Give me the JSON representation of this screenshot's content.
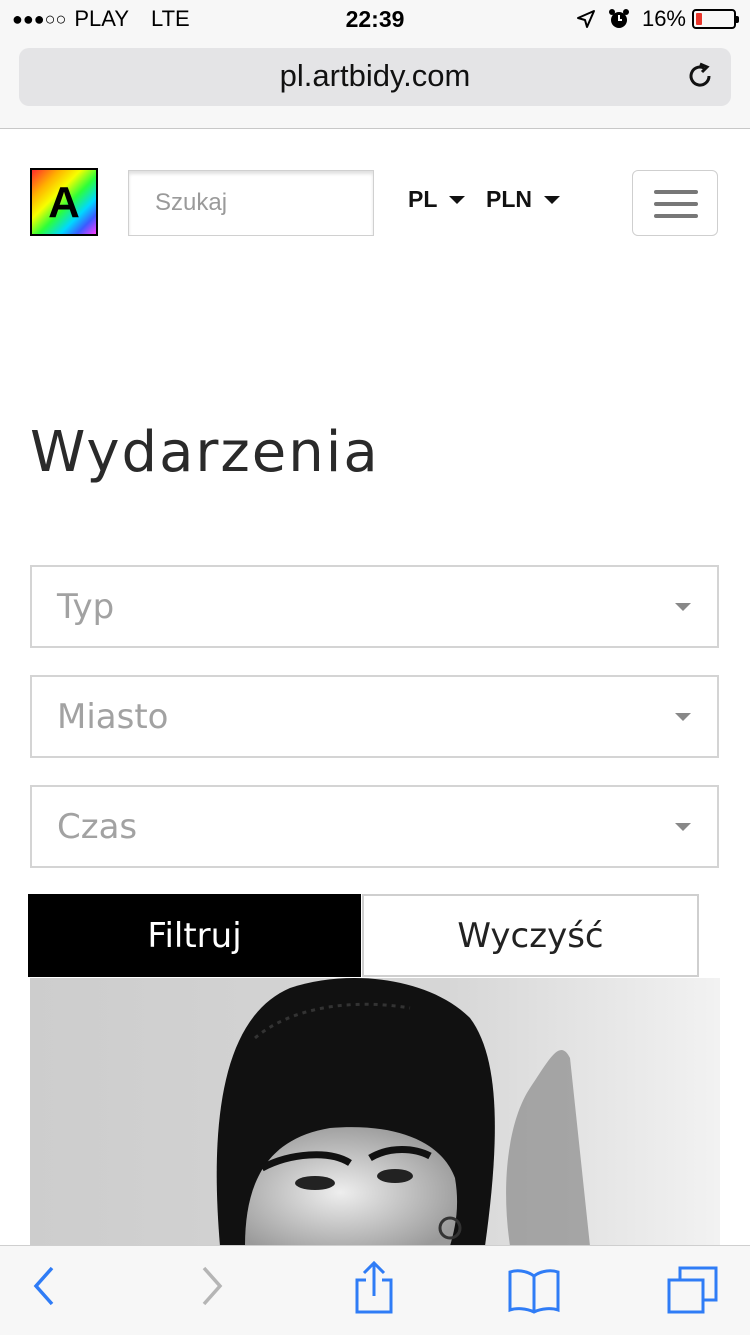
{
  "status_bar": {
    "signal_dots": "●●●○○",
    "carrier": "PLAY",
    "network": "LTE",
    "time": "22:39",
    "battery_percent": "16%",
    "battery_level": 0.16,
    "battery_color": "#e8352b"
  },
  "browser": {
    "url": "pl.artbidy.com",
    "icons": {
      "reload": "reload-icon",
      "back": "back-arrow-icon",
      "forward": "forward-arrow-icon",
      "share": "share-icon",
      "bookmarks": "bookmarks-icon",
      "tabs": "tabs-icon"
    },
    "accent_color": "#2f7cf6"
  },
  "header": {
    "logo_letter": "A",
    "search_placeholder": "Szukaj",
    "language": "PL",
    "currency": "PLN",
    "menu_icon": "hamburger-menu-icon"
  },
  "main": {
    "title": "Wydarzenia",
    "filters": [
      {
        "placeholder": "Typ"
      },
      {
        "placeholder": "Miasto"
      },
      {
        "placeholder": "Czas"
      }
    ],
    "filter_button": "Filtruj",
    "clear_button": "Wyczyść"
  }
}
